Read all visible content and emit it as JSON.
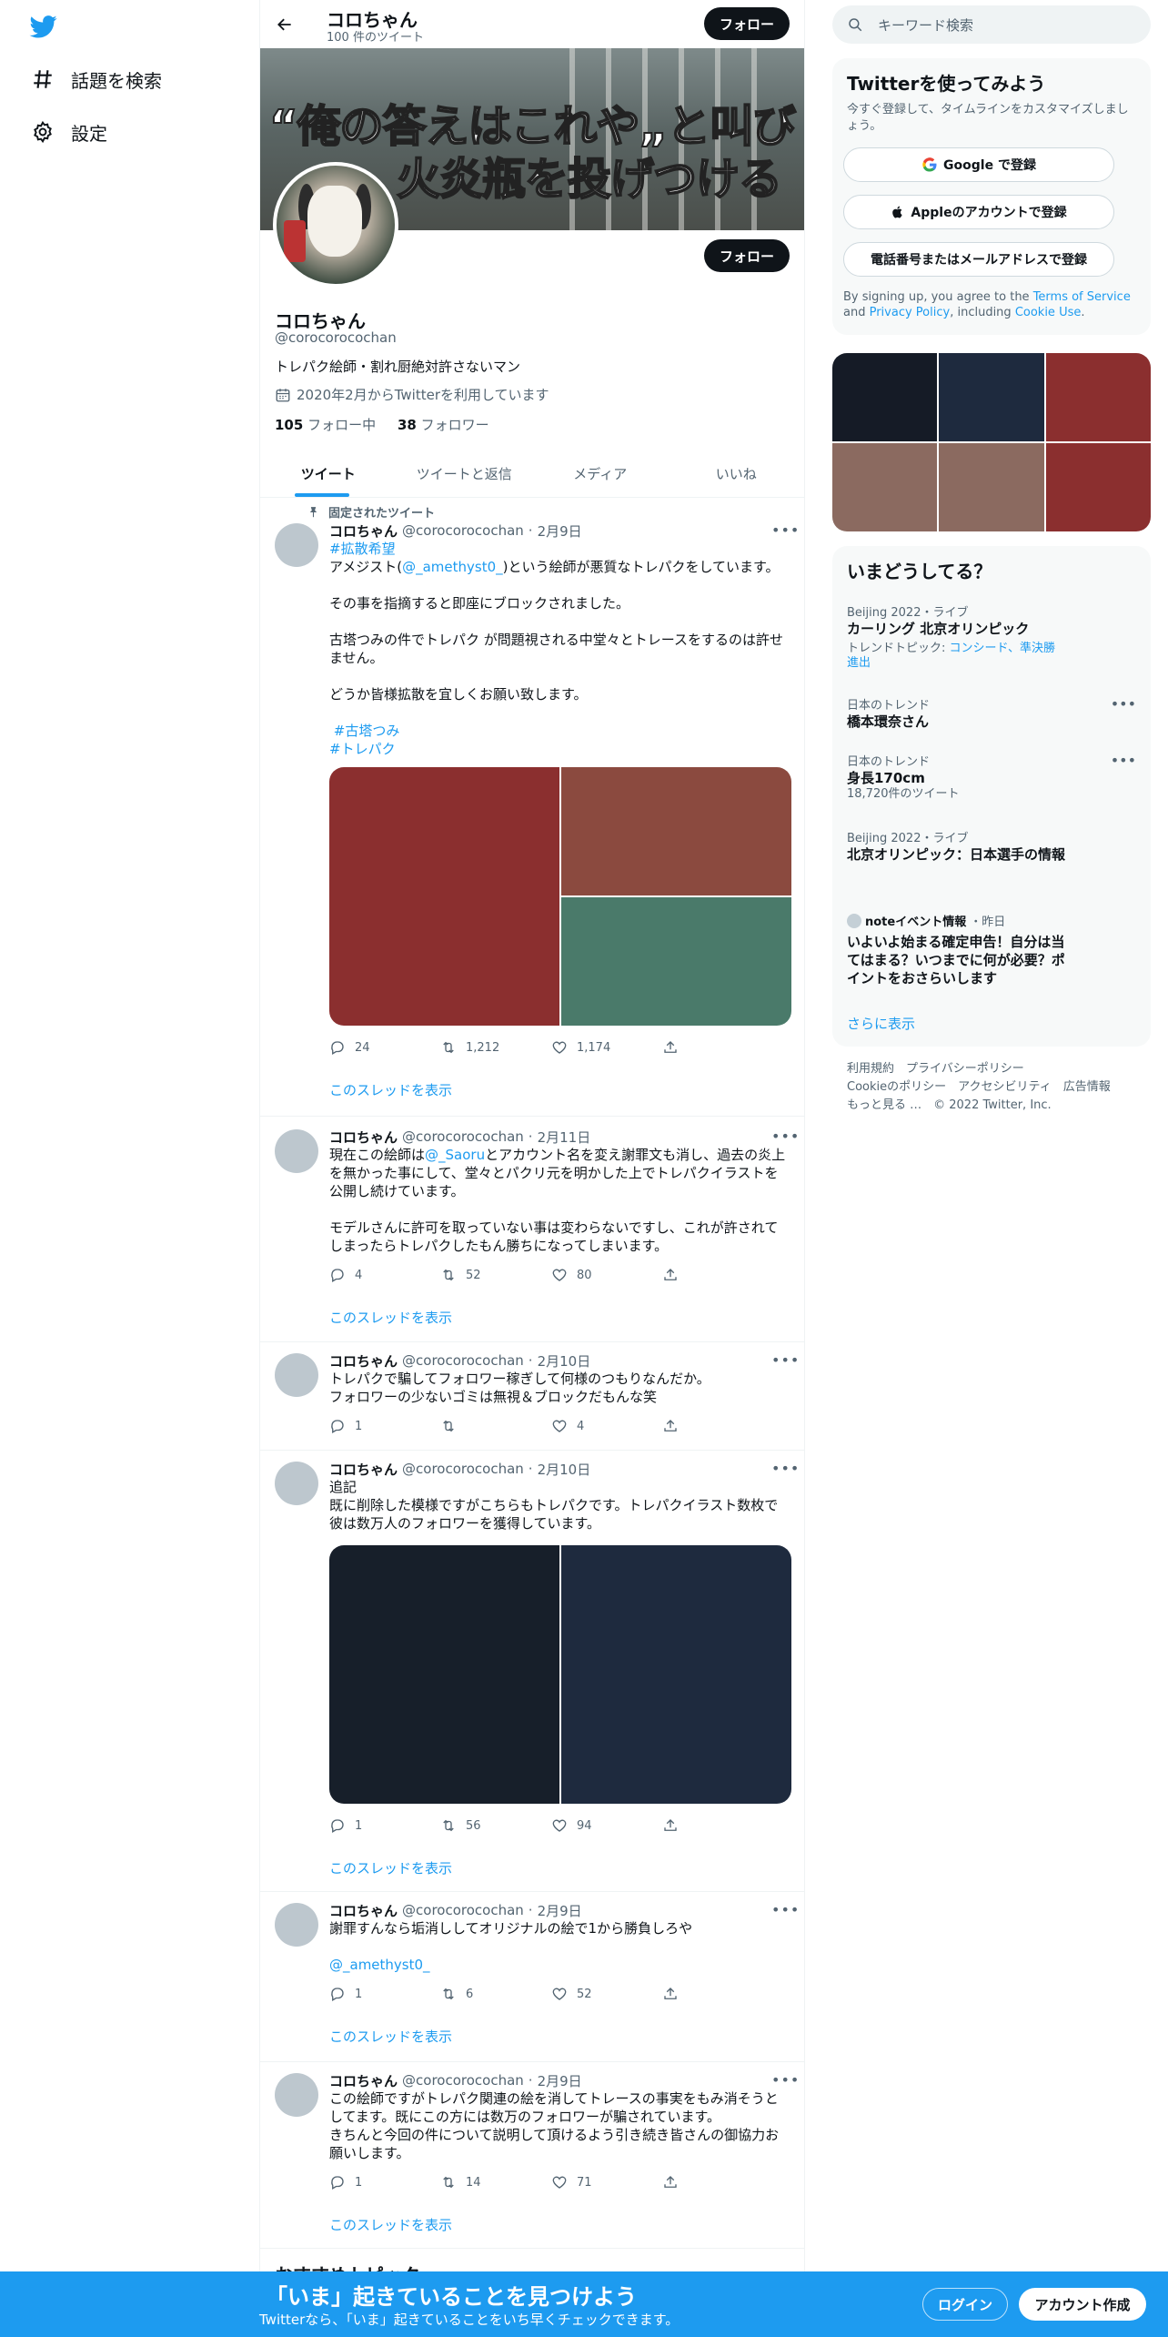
{
  "sidebar": {
    "items": [
      {
        "label": "話題を検索",
        "icon": "hashtag-icon"
      },
      {
        "label": "設定",
        "icon": "gear-icon"
      }
    ]
  },
  "header": {
    "name": "コロちゃん",
    "tweet_count": "100 件のツイート",
    "follow_label": "フォロー"
  },
  "banner": {
    "line1": "“俺の答えはこれや„と叫び",
    "line2": "火炎瓶を投げつける"
  },
  "profile": {
    "name": "コロちゃん",
    "handle": "@corocorocochan",
    "bio": "トレパク絵師・割れ厨絶対許さないマン",
    "joined": "2020年2月からTwitterを利用しています",
    "following_count": "105",
    "following_label": "フォロー中",
    "followers_count": "38",
    "followers_label": "フォロワー",
    "follow_label": "フォロー"
  },
  "tabs": [
    "ツイート",
    "ツイートと返信",
    "メディア",
    "いいね"
  ],
  "pinned_label": "固定されたツイート",
  "thread_label": "このスレッドを表示",
  "tweets": [
    {
      "name": "コロちゃん",
      "handle": "@corocorocochan",
      "date": "2月9日",
      "tag_top": "#拡散希望",
      "text_a": "アメジスト(",
      "mention": "@_amethyst0_",
      "text_b": ")という絵師が悪質なトレパクをしています。\n\nその事を指摘すると即座にブロックされました。\n\n古塔つみの件でトレパク が問題視される中堂々とトレースをするのは許せません。\n\nどうか皆様拡散を宜しくお願い致します。\n",
      "tags": [
        "#古塔つみ",
        "#トレパク"
      ],
      "replies": "24",
      "retweets": "1,212",
      "likes": "1,174",
      "media_colors": [
        "#8b2f2f",
        "#8b4a3f",
        "#4a7a6a"
      ]
    },
    {
      "name": "コロちゃん",
      "handle": "@corocorocochan",
      "date": "2月11日",
      "text_a": "現在この絵師は",
      "mention": "@_Saoru",
      "text_b": "とアカウント名を変え謝罪文も消し、過去の炎上を無かった事にして、堂々とパクリ元を明かした上でトレパクイラストを公開し続けています。\n\nモデルさんに許可を取っていない事は変わらないですし、これが許されてしまったらトレパクしたもん勝ちになってしまいます。",
      "replies": "4",
      "retweets": "52",
      "likes": "80"
    },
    {
      "name": "コロちゃん",
      "handle": "@corocorocochan",
      "date": "2月10日",
      "text": "トレパクで騙してフォロワー稼ぎして何様のつもりなんだか。\nフォロワーの少ないゴミは無視＆ブロックだもんな笑",
      "replies": "1",
      "retweets": "",
      "likes": "4"
    },
    {
      "name": "コロちゃん",
      "handle": "@corocorocochan",
      "date": "2月10日",
      "text": "追記\n既に削除した模様ですがこちらもトレパクです。トレパクイラスト数枚で彼は数万人のフォロワーを獲得しています。",
      "replies": "1",
      "retweets": "56",
      "likes": "94",
      "media_colors": [
        "#171f2a",
        "#1e2a3e"
      ]
    },
    {
      "name": "コロちゃん",
      "handle": "@corocorocochan",
      "date": "2月9日",
      "text": "謝罪すんなら垢消ししてオリジナルの絵で1から勝負しろや",
      "mention_line": "@_amethyst0_",
      "replies": "1",
      "retweets": "6",
      "likes": "52"
    },
    {
      "name": "コロちゃん",
      "handle": "@corocorocochan",
      "date": "2月9日",
      "text": "この絵師ですがトレパク関連の絵を消してトレースの事実をもみ消そうとしてます。既にこの方には数万のフォロワーが騙されています。\nきちんと今回の件について説明して頂けるよう引き続き皆さんの御協力お願いします。",
      "replies": "1",
      "retweets": "14",
      "likes": "71"
    }
  ],
  "recs_title": "おすすめトピック",
  "search": {
    "placeholder": "キーワード検索"
  },
  "signup": {
    "title": "Twitterを使ってみよう",
    "subtitle": "今すぐ登録して、タイムラインをカスタマイズしましょう。",
    "google": "Google で登録",
    "apple": "Appleのアカウントで登録",
    "phone": "電話番号またはメールアドレスで登録",
    "legal_a": "By signing up, you agree to the ",
    "terms": "Terms of Service",
    "legal_b": " and ",
    "privacy": "Privacy Policy",
    "legal_c": ", including ",
    "cookie": "Cookie Use",
    "legal_d": "."
  },
  "media_grid_colors": [
    "#151b26",
    "#1e2a3e",
    "#8b2f2f",
    "#8b6a60",
    "#8b6a60",
    "#8b2f2f"
  ],
  "trends": {
    "title": "いまどうしてる？",
    "items": [
      {
        "meta": "Beijing 2022・ライブ",
        "title": "カーリング 北京オリンピック",
        "sub_a": "トレンドトピック: ",
        "sub_links": "コンシード、準決勝進出"
      },
      {
        "meta": "日本のトレンド",
        "title": "橋本環奈さん"
      },
      {
        "meta": "日本のトレンド",
        "title": "身長170cm",
        "count": "18,720件のツイート"
      },
      {
        "meta": "Beijing 2022・ライブ",
        "title": "北京オリンピック：日本選手の情報"
      },
      {
        "meta_name": "noteイベント情報",
        "meta_time": "・昨日",
        "title": "いよいよ始まる確定申告！自分は当てはまる？いつまでに何が必要？ポイントをおさらいします"
      }
    ],
    "show_more": "さらに表示"
  },
  "footer": {
    "line1": "利用規約　プライバシーポリシー",
    "line2": "Cookieのポリシー　アクセシビリティ　広告情報",
    "line3": "もっと見る …　© 2022 Twitter, Inc."
  },
  "bottom_bar": {
    "title": "「いま」起きていることを見つけよう",
    "subtitle": "Twitterなら、「いま」起きていることをいち早くチェックできます。",
    "login": "ログイン",
    "signup": "アカウント作成"
  },
  "colors": {
    "accent": "#1d9bf0",
    "text": "#0f1419",
    "secondary": "#536471"
  }
}
